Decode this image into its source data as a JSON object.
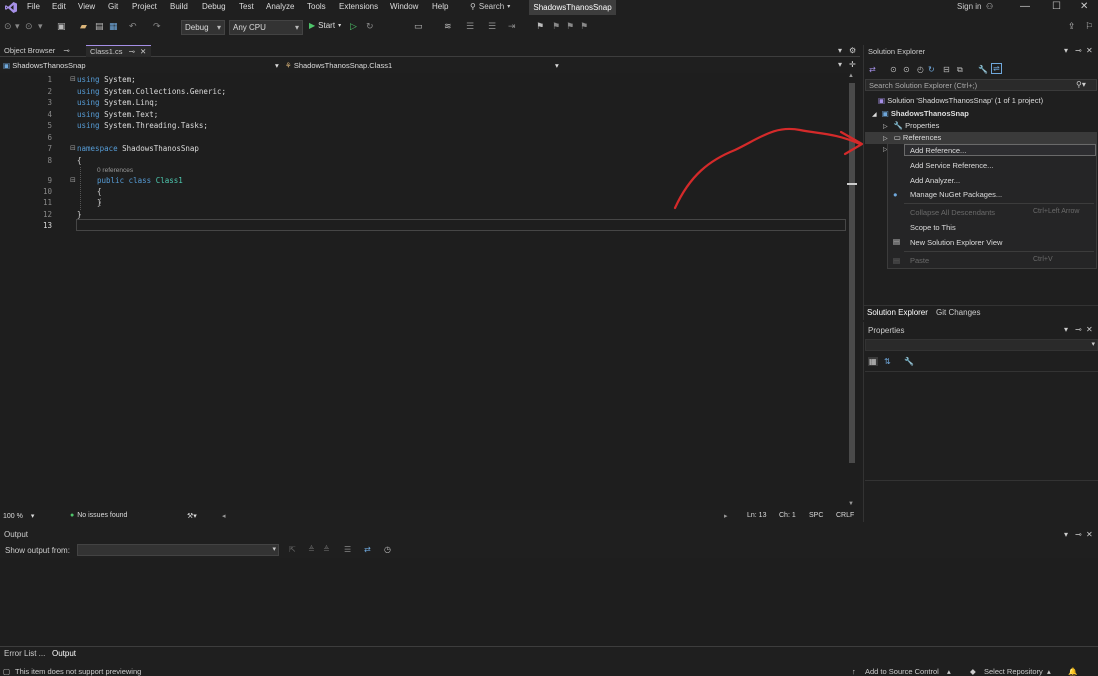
{
  "menu": {
    "items": [
      "File",
      "Edit",
      "View",
      "Git",
      "Project",
      "Build",
      "Debug",
      "Test",
      "Analyze",
      "Tools",
      "Extensions",
      "Window",
      "Help"
    ],
    "search_label": "Search",
    "title": "ShadowsThanosSnap",
    "sign_in": "Sign in"
  },
  "toolbar": {
    "config": "Debug",
    "platform": "Any CPU",
    "start_label": "Start"
  },
  "tabs": {
    "object_browser": "Object Browser",
    "class1": "Class1.cs"
  },
  "navbar": {
    "project": "ShadowsThanosSnap",
    "type": "ShadowsThanosSnap.Class1"
  },
  "editor": {
    "lines": [
      "1",
      "2",
      "3",
      "4",
      "5",
      "6",
      "7",
      "8",
      "9",
      "10",
      "11",
      "12",
      "13"
    ],
    "code": {
      "l1a": "using",
      "l1b": " System;",
      "l2a": "using",
      "l2b": " System.Collections.Generic;",
      "l3a": "using",
      "l3b": " System.Linq;",
      "l4a": "using",
      "l4b": " System.Text;",
      "l5a": "using",
      "l5b": " System.Threading.Tasks;",
      "l7a": "namespace",
      "l7b": " ShadowsThanosSnap",
      "l8": "{",
      "refs": "0 references",
      "l9a": "public class",
      "l9b": " Class1",
      "l10": "{",
      "l11": "}",
      "l12": "}"
    }
  },
  "editor_status": {
    "zoom": "100 %",
    "issues": "No issues found",
    "line": "Ln: 13",
    "char": "Ch: 1",
    "spc": "SPC",
    "crlf": "CRLF"
  },
  "output": {
    "title": "Output",
    "show_from": "Show output from:"
  },
  "bottom_tabs": {
    "error_list": "Error List ...",
    "output": "Output"
  },
  "statusbar": {
    "message": "This item does not support previewing",
    "add_source": "Add to Source Control",
    "select_repo": "Select Repository"
  },
  "solution_explorer": {
    "title": "Solution Explorer",
    "search_placeholder": "Search Solution Explorer (Ctrl+;)",
    "solution": "Solution 'ShadowsThanosSnap' (1 of 1 project)",
    "project": "ShadowsThanosSnap",
    "properties": "Properties",
    "references": "References",
    "tab_se": "Solution Explorer",
    "tab_git": "Git Changes"
  },
  "context_menu": {
    "add_reference": "Add Reference...",
    "add_service_reference": "Add Service Reference...",
    "add_analyzer": "Add Analyzer...",
    "manage_nuget": "Manage NuGet Packages...",
    "collapse_all": "Collapse All Descendants",
    "collapse_shortcut": "Ctrl+Left Arrow",
    "scope_to_this": "Scope to This",
    "new_view": "New Solution Explorer View",
    "paste": "Paste",
    "paste_shortcut": "Ctrl+V"
  },
  "properties": {
    "title": "Properties"
  },
  "colors": {
    "annotation_arrow": "#d42a2a",
    "keyword": "#569cd6",
    "type": "#4ec9b0"
  }
}
